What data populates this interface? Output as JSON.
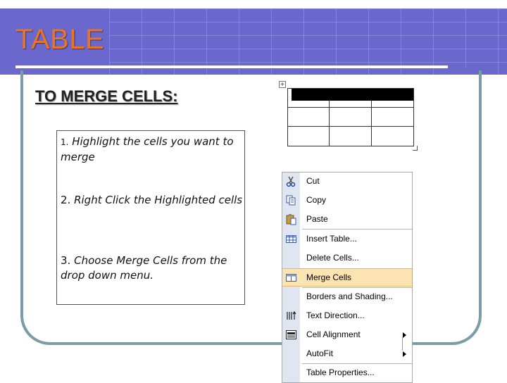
{
  "slide": {
    "title": "TABLE",
    "subtitle": "TO MERGE CELLS:",
    "colors": {
      "header": "#6a68cc",
      "title": "#e8742a",
      "frame": "#7a9ca6"
    }
  },
  "steps": [
    {
      "number": "1.",
      "text": "Highlight the cells you want to merge"
    },
    {
      "number": "2.",
      "text": "Right Click the Highlighted cells"
    },
    {
      "number": "3.",
      "text": "Choose Merge Cells from the drop down menu."
    }
  ],
  "table_illustration": {
    "move_handle_icon": "move-handle-icon",
    "rows": 3,
    "columns": 3,
    "highlighted_row": 1
  },
  "context_menu": {
    "items": [
      {
        "label": "Cut",
        "icon": "scissors-icon"
      },
      {
        "label": "Copy",
        "icon": "copy-icon"
      },
      {
        "label": "Paste",
        "icon": "paste-icon"
      },
      {
        "label": "Insert Table...",
        "icon": "insert-table-icon"
      },
      {
        "label": "Delete Cells...",
        "icon": ""
      },
      {
        "label": "Merge Cells",
        "icon": "merge-cells-icon",
        "highlighted": true
      },
      {
        "label": "Borders and Shading...",
        "icon": ""
      },
      {
        "label": "Text Direction...",
        "icon": "text-direction-icon"
      },
      {
        "label": "Cell Alignment",
        "icon": "cell-alignment-icon",
        "submenu": true
      },
      {
        "label": "AutoFit",
        "icon": "",
        "submenu": true
      },
      {
        "label": "Table Properties...",
        "icon": ""
      }
    ]
  }
}
